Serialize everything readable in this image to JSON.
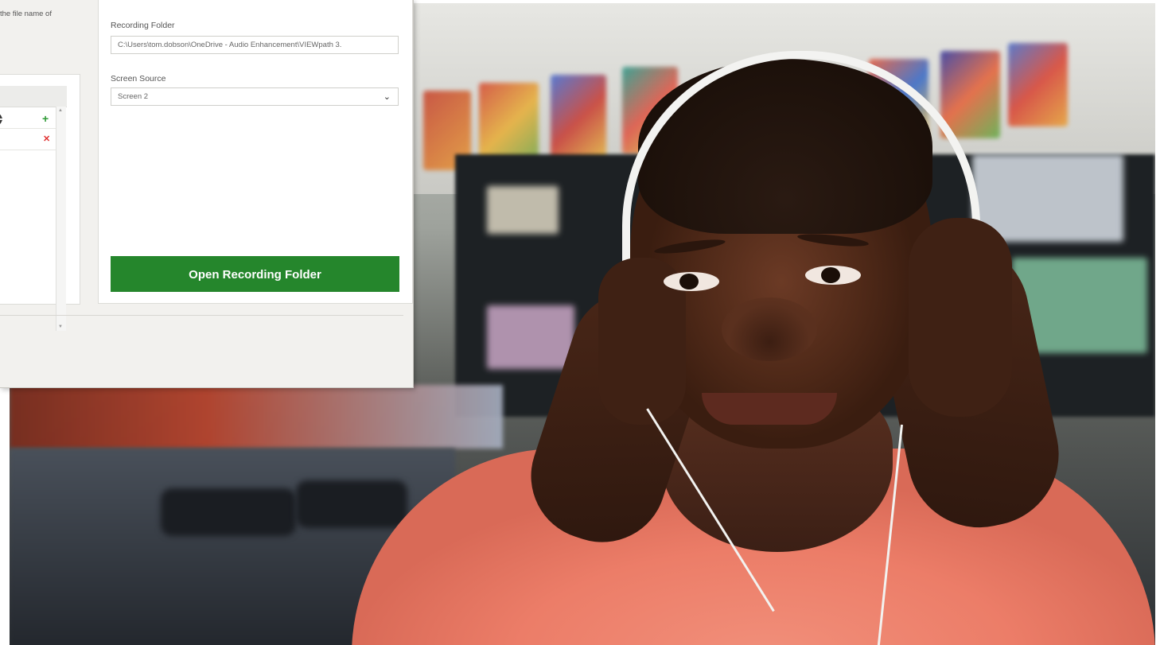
{
  "dialog": {
    "hint_text": "the file name of",
    "recording_folder": {
      "label": "Recording Folder",
      "value": "C:\\Users\\tom.dobson\\OneDrive - Audio Enhancement\\VIEWpath 3."
    },
    "screen_source": {
      "label": "Screen Source",
      "selected": "Screen 2"
    },
    "open_button_label": "Open Recording Folder"
  },
  "icons": {
    "add": "plus-icon",
    "remove": "x-icon",
    "stepper": "stepper-icon",
    "dropdown": "chevron-down-icon"
  },
  "colors": {
    "button_green": "#25862c",
    "add_green": "#2e9a35",
    "remove_red": "#e03030"
  },
  "photo": {
    "subject": "boy wearing headphones in classroom"
  }
}
